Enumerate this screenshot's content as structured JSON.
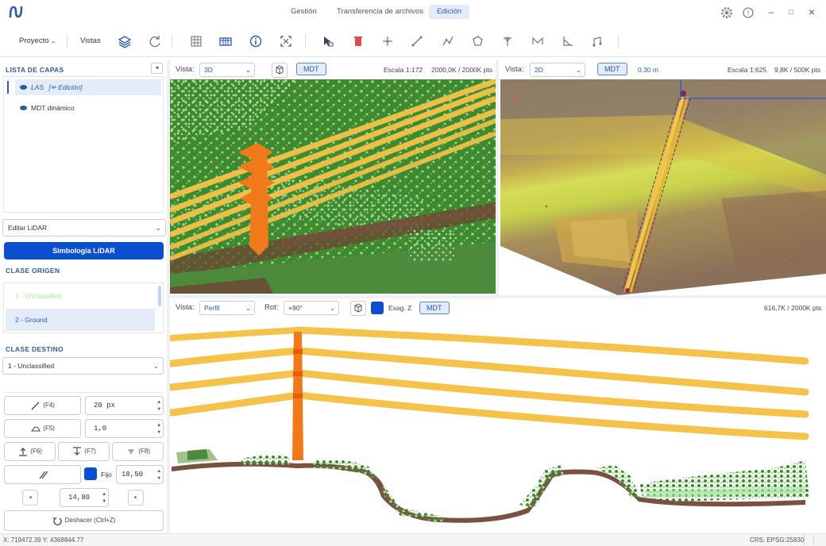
{
  "nav": {
    "tabs": [
      {
        "label": "Gestión"
      },
      {
        "label": "Transferencia de archivos"
      },
      {
        "label": "Edición"
      }
    ]
  },
  "toolbar": {
    "project_label": "Proyecto",
    "views_label": "Vistas"
  },
  "layers": {
    "header": "LISTA DE CAPAS",
    "items": [
      {
        "name": "LAS",
        "tag": "[✏ Edición]"
      },
      {
        "name": "MDT dinámico"
      }
    ]
  },
  "edit": {
    "mode": "Editar LiDAR",
    "symbology_button": "Simbología LiDAR",
    "source_header": "CLASE ORIGEN",
    "source_classes": [
      "1 - Unclassified",
      "2 - Ground"
    ],
    "target_header": "CLASE DESTINO",
    "target_class": "1 - Unclassified",
    "tools": {
      "f4": "(F4)",
      "brush_size": "20 px",
      "f5": "(F5)",
      "f5_value": "1,0",
      "f6": "(F6)",
      "f7": "(F7)",
      "f8": "(F8)",
      "fixed_label": "Fijo",
      "fixed_value": "18,50",
      "step_value": "14,80",
      "undo": "Deshacer (Ctrl+Z)"
    }
  },
  "view3d": {
    "vista_label": "Vista:",
    "mode": "3D",
    "mdt": "MDT",
    "scale": "Escala 1:172",
    "pts": "2000,0K / 2000K pts"
  },
  "view2d": {
    "vista_label": "Vista:",
    "mode": "2D",
    "mdt": "MDT",
    "res": "0.30 m",
    "scale": "Escala 1:625",
    "pts": "9,8K / 500K pts"
  },
  "profile": {
    "vista_label": "Vista:",
    "mode": "Perfil",
    "rot_label": "Rot:",
    "rot": "+90°",
    "exag_label": "Exag. Z",
    "mdt": "MDT",
    "pts": "616,7K / 2000K pts"
  },
  "status": {
    "coords": "X: 719472.39  Y: 4368844.77",
    "crs": "CRS: EPSG:25830"
  },
  "colors": {
    "accent": "#0b4fd1",
    "tower": "#f07a1a",
    "wire": "#f5c24a",
    "vegetation": "#3f8a2e",
    "ground": "#7a5040"
  }
}
